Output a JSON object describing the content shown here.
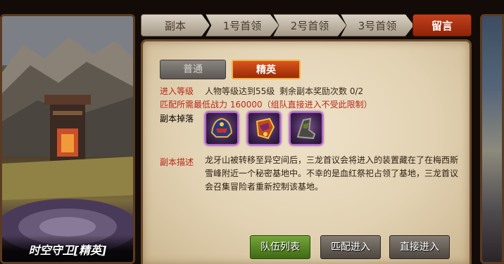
{
  "dungeon_card": {
    "title": "时空守卫[精英]"
  },
  "tabs": [
    {
      "label": "副本"
    },
    {
      "label": "1号首领"
    },
    {
      "label": "2号首领"
    },
    {
      "label": "3号首领"
    }
  ],
  "message_tab": {
    "label": "留言"
  },
  "mode": {
    "normal_label": "普通",
    "elite_label": "精英",
    "selected": "精英"
  },
  "info": {
    "level_label": "进入等级",
    "level_req": "人物等级达到55级",
    "reward_left": "剩余副本奖励次数 0/2",
    "power_req": "匹配所需最低战力 160000（组队直接进入不受此限制）",
    "drops_label": "副本掉落"
  },
  "drops": [
    {
      "icon": "helmet-icon"
    },
    {
      "icon": "gauntlet-icon"
    },
    {
      "icon": "boots-icon"
    }
  ],
  "description": {
    "label": "副本描述",
    "text": "龙牙山被转移至异空间后，三龙首议会将进入的装置藏在了在梅西斯雪峰附近一个秘密基地中。不幸的是血红祭祀占领了基地，三龙首议会召集冒险者重新控制该基地。"
  },
  "actions": {
    "team_list": "队伍列表",
    "match_enter": "匹配进入",
    "direct_enter": "直接进入"
  },
  "colors": {
    "accent_red": "#b8281a",
    "elite_orange": "#d9541e",
    "green_button": "#76a53a",
    "item_border_purple": "#b560d8"
  }
}
